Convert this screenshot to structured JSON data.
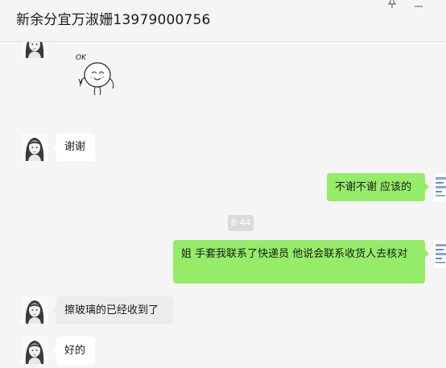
{
  "window": {
    "title": "新余分宜万淑姗13979000756"
  },
  "icons": {
    "pin": "pin-icon",
    "minimize": "minimize-icon"
  },
  "sticker": {
    "text": "OK"
  },
  "messages": [
    {
      "sender": "contact",
      "type": "text",
      "text": "谢谢"
    },
    {
      "sender": "me",
      "type": "text",
      "text": "不谢不谢 应该的"
    },
    {
      "type": "time",
      "text": "8:44"
    },
    {
      "sender": "me",
      "type": "text",
      "text": "姐  手套我联系了快递员 他说会联系收货人去核对"
    },
    {
      "sender": "contact",
      "type": "text",
      "text": "擦玻璃的已经收到了"
    },
    {
      "sender": "contact",
      "type": "text",
      "text": "好的"
    }
  ],
  "colors": {
    "background": "#f5f5f5",
    "outgoing_bubble": "#95ec69",
    "incoming_bubble": "#ffffff",
    "time_chip": "#dadada"
  }
}
